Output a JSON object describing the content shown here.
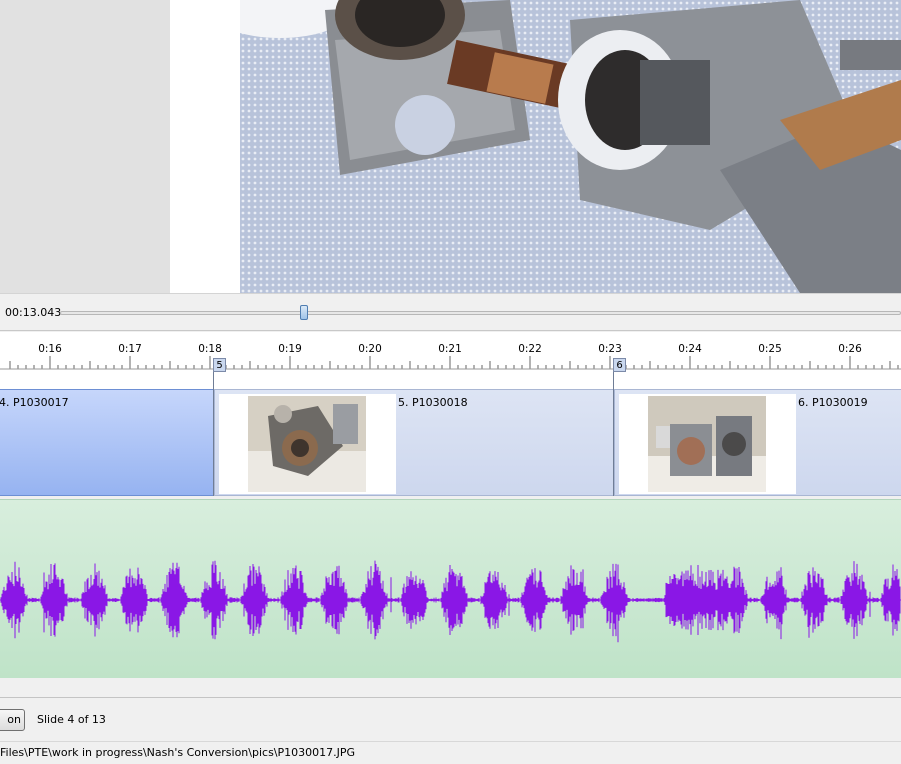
{
  "playback": {
    "time": "00:13.043",
    "position_fraction": 0.29
  },
  "timeline": {
    "ticks": [
      "0:16",
      "0:17",
      "0:18",
      "0:19",
      "0:20",
      "0:21",
      "0:22",
      "0:23",
      "0:24",
      "0:25",
      "0:26"
    ],
    "markers": [
      "5",
      "6"
    ]
  },
  "slides": [
    {
      "label": "4. P1030017"
    },
    {
      "label": "5. P1030018"
    },
    {
      "label": "6. P1030019"
    }
  ],
  "toolbar": {
    "button_label": "on",
    "slide_status": "Slide 4 of 13"
  },
  "status": {
    "file_path": "Files\\PTE\\work in progress\\Nash's Conversion\\pics\\P1030017.JPG"
  },
  "colors": {
    "waveform": "#8a17e6",
    "active_slide": "#96b3f1",
    "audio_bg": "#c9e7d1"
  }
}
